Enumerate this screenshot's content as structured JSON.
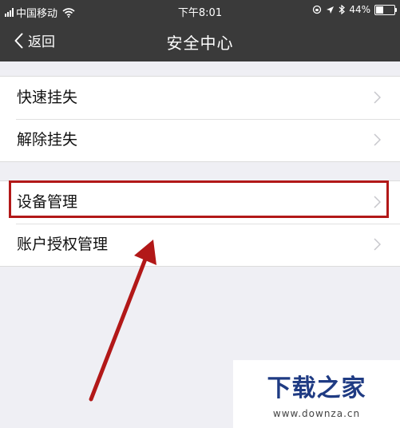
{
  "status_bar": {
    "carrier": "中国移动",
    "time": "下午8:01",
    "battery": "44%",
    "battery_level": 0.44
  },
  "nav": {
    "back_label": "返回",
    "title": "安全中心"
  },
  "group1": {
    "items": [
      {
        "label": "快速挂失"
      },
      {
        "label": "解除挂失"
      }
    ]
  },
  "group2": {
    "items": [
      {
        "label": "设备管理"
      },
      {
        "label": "账户授权管理"
      }
    ]
  },
  "watermark": {
    "logo": "下载之家",
    "url": "www.downza.cn"
  },
  "colors": {
    "nav_bg": "#3a3a3a",
    "highlight": "#b21818",
    "watermark_logo": "#1f3b83",
    "page_bg": "#efeff4"
  }
}
